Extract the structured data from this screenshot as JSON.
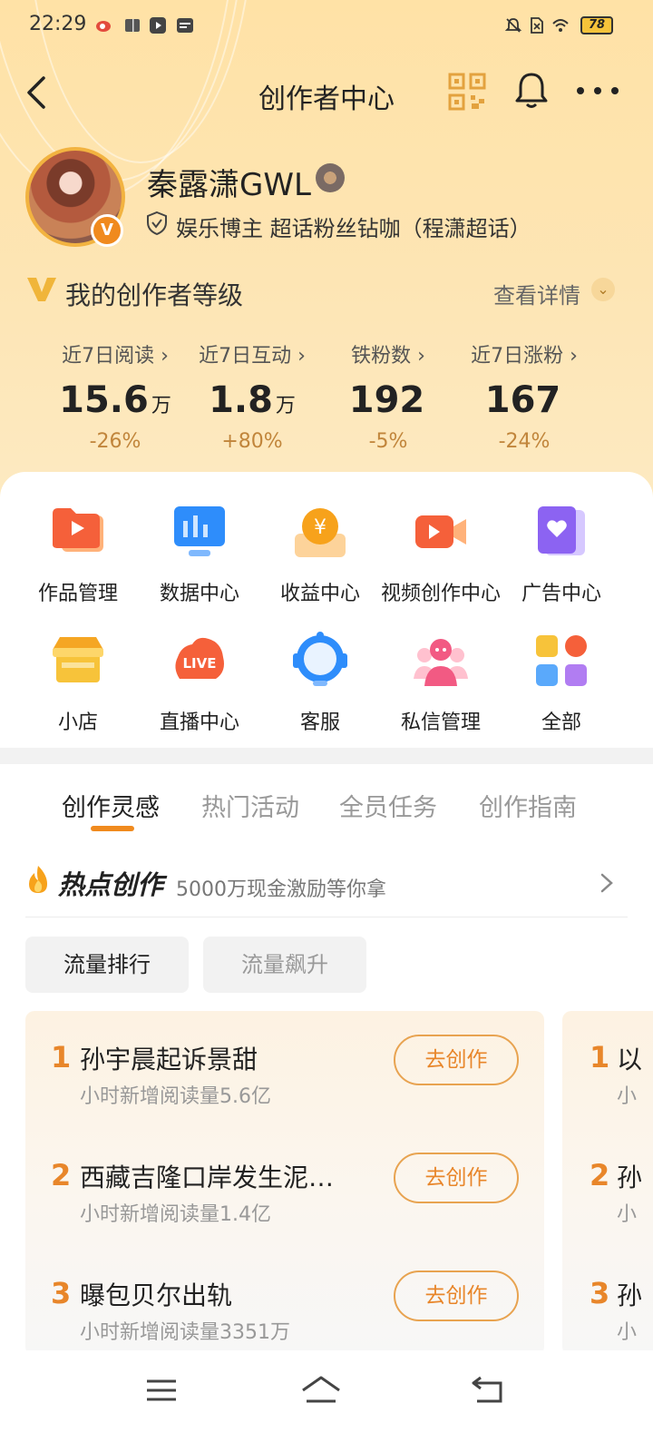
{
  "status_bar": {
    "time": "22:29",
    "battery": "78"
  },
  "nav": {
    "title": "创作者中心"
  },
  "profile": {
    "name": "秦露潇GWL",
    "description": "娱乐博主 超话粉丝钻咖（程潇超话）",
    "badge": "V"
  },
  "level": {
    "title": "我的创作者等级",
    "detail_label": "查看详情"
  },
  "stats": [
    {
      "label": "近7日阅读 ›",
      "value": "15.6",
      "unit": "万",
      "change": "-26%"
    },
    {
      "label": "近7日互动 ›",
      "value": "1.8",
      "unit": "万",
      "change": "+80%"
    },
    {
      "label": "铁粉数 ›",
      "value": "192",
      "unit": "",
      "change": "-5%"
    },
    {
      "label": "近7日涨粉 ›",
      "value": "167",
      "unit": "",
      "change": "-24%"
    }
  ],
  "tools": [
    {
      "label": "作品管理",
      "icon": "works-manage-icon"
    },
    {
      "label": "数据中心",
      "icon": "data-center-icon"
    },
    {
      "label": "收益中心",
      "icon": "income-center-icon"
    },
    {
      "label": "视频创作中心",
      "icon": "video-creation-icon"
    },
    {
      "label": "广告中心",
      "icon": "ad-center-icon"
    },
    {
      "label": "小店",
      "icon": "shop-icon"
    },
    {
      "label": "直播中心",
      "icon": "live-center-icon"
    },
    {
      "label": "客服",
      "icon": "customer-service-icon"
    },
    {
      "label": "私信管理",
      "icon": "messages-manage-icon"
    },
    {
      "label": "全部",
      "icon": "all-apps-icon"
    }
  ],
  "live_icon_text": "LIVE",
  "tabs": [
    "创作灵感",
    "热门活动",
    "全员任务",
    "创作指南"
  ],
  "hot": {
    "title": "热点创作",
    "subtitle": "5000万现金激励等你拿"
  },
  "filters": [
    "流量排行",
    "流量飙升"
  ],
  "ranking": [
    {
      "rank": "1",
      "title": "孙宇晨起诉景甜",
      "sub": "小时新增阅读量5.6亿",
      "button": "去创作"
    },
    {
      "rank": "2",
      "title": "西藏吉隆口岸发生泥…",
      "sub": "小时新增阅读量1.4亿",
      "button": "去创作"
    },
    {
      "rank": "3",
      "title": "曝包贝尔出轨",
      "sub": "小时新增阅读量3351万",
      "button": "去创作"
    }
  ],
  "ranking_peek": [
    {
      "rank": "1",
      "title": "以",
      "sub": "小"
    },
    {
      "rank": "2",
      "title": "孙",
      "sub": "小"
    },
    {
      "rank": "3",
      "title": "孙",
      "sub": "小"
    }
  ],
  "colors": {
    "accent": "#f08a1e",
    "hero_bg": "#fde5b4"
  }
}
